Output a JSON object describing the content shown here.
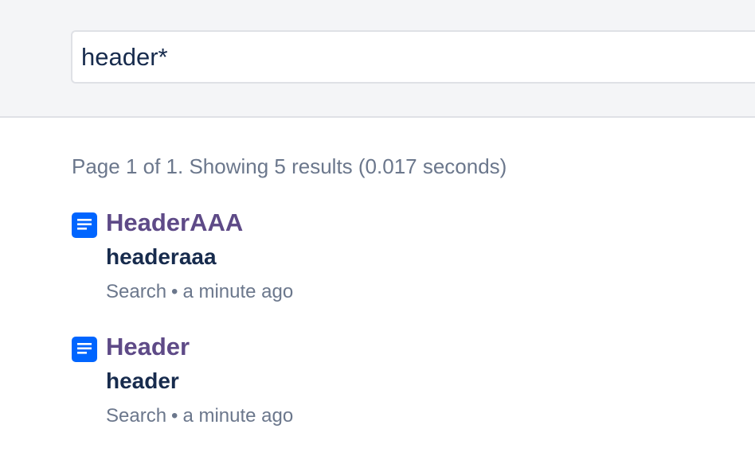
{
  "search": {
    "query": "header*"
  },
  "summary": "Page 1 of 1. Showing 5 results (0.017 seconds)",
  "results": [
    {
      "icon": "page-icon",
      "title": "HeaderAAA",
      "excerpt": "headeraaa",
      "space": "Search",
      "separator": "•",
      "time": "a minute ago"
    },
    {
      "icon": "page-icon",
      "title": "Header",
      "excerpt": "header",
      "space": "Search",
      "separator": "•",
      "time": "a minute ago"
    }
  ],
  "colors": {
    "header_bg": "#f4f5f7",
    "icon_blue": "#0065ff",
    "title_purple": "#5e4a87",
    "text_dark": "#172b4d",
    "text_muted": "#6b778c"
  }
}
